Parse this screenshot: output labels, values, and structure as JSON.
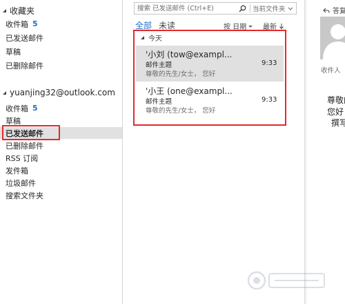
{
  "favorites": {
    "header": "收藏夹",
    "items": [
      {
        "label": "收件箱",
        "count": "5"
      },
      {
        "label": "已发送邮件",
        "count": ""
      },
      {
        "label": "草稿",
        "count": ""
      },
      {
        "label": "已删除邮件",
        "count": ""
      }
    ]
  },
  "account": {
    "header": "yuanjing32@outlook.com",
    "items": [
      {
        "label": "收件箱",
        "count": "5"
      },
      {
        "label": "草稿",
        "count": ""
      },
      {
        "label": "已发送邮件",
        "count": "",
        "selected": true
      },
      {
        "label": "已删除邮件",
        "count": ""
      },
      {
        "label": "RSS 订阅",
        "count": ""
      },
      {
        "label": "发件箱",
        "count": ""
      },
      {
        "label": "垃圾邮件",
        "count": ""
      },
      {
        "label": "搜索文件夹",
        "count": ""
      }
    ]
  },
  "search": {
    "placeholder": "搜索 已发送邮件 (Ctrl+E)",
    "scope": "当前文件夹"
  },
  "filters": {
    "all": "全部",
    "unread": "未读",
    "sort_by": "按 日期",
    "order": "最新"
  },
  "list": {
    "group": "今天",
    "messages": [
      {
        "sender": "'小刘 (tow@exampl...",
        "subject": "邮件主题",
        "time": "9:33",
        "preview": "尊敬的先生/女士，  您好"
      },
      {
        "sender": "'小王 (one@exampl...",
        "subject": "邮件主题",
        "time": "9:33",
        "preview": "尊敬的先生/女士，  您好"
      }
    ]
  },
  "reading": {
    "header": "答复",
    "recipient_label": "收件人",
    "body_line1": "尊敬的",
    "body_line2": "您好",
    "body_line3": "撰写"
  },
  "colors": {
    "accent": "#1e6fc7",
    "highlight": "#e5272c",
    "selection": "#e1e1e1"
  },
  "icons": [
    "triangle-down-icon",
    "search-icon",
    "chevron-down-icon",
    "arrow-down-icon",
    "reply-icon",
    "avatar-silhouette-icon"
  ]
}
